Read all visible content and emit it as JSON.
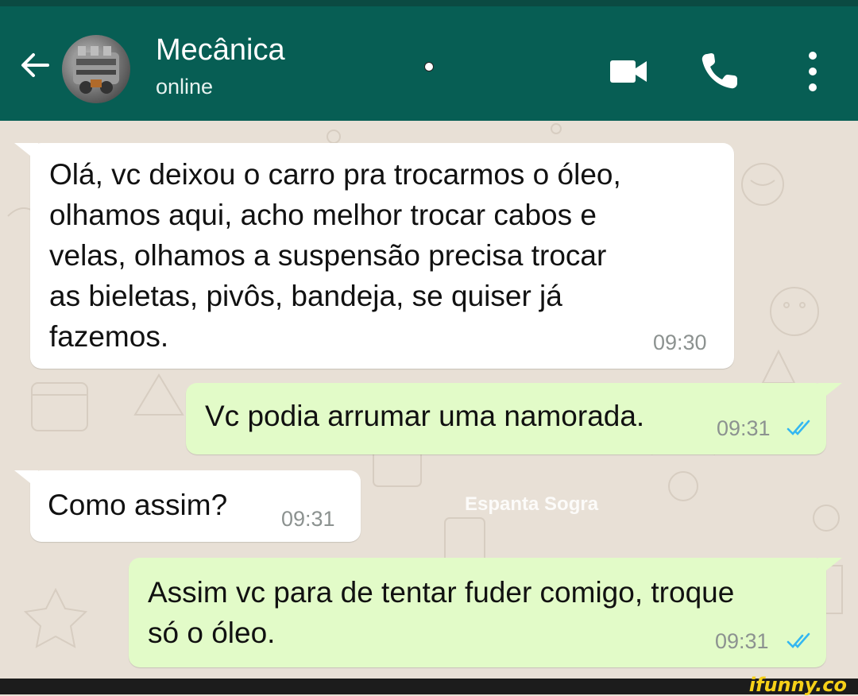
{
  "header": {
    "contact_name": "Mecânica",
    "status": "online",
    "icons": [
      "back-arrow-icon",
      "video-call-icon",
      "voice-call-icon",
      "more-options-icon"
    ]
  },
  "messages": [
    {
      "direction": "in",
      "text_lines": [
        "Olá, vc deixou o carro pra trocarmos o óleo,",
        "olhamos aqui, acho melhor trocar cabos e",
        "velas, olhamos a suspensão precisa trocar",
        "as bieletas, pivôs, bandeja, se quiser já",
        "fazemos."
      ],
      "time": "09:30"
    },
    {
      "direction": "out",
      "text_lines": [
        "Vc podia arrumar uma namorada."
      ],
      "time": "09:31",
      "status": "read"
    },
    {
      "direction": "in",
      "text_lines": [
        "Como assim?"
      ],
      "time": "09:31"
    },
    {
      "direction": "out",
      "text_lines": [
        "Assim vc para de tentar fuder comigo, troque",
        "só o óleo."
      ],
      "time": "09:31",
      "status": "read"
    }
  ],
  "watermark": "Espanta Sogra",
  "footer_brand": "ifunny.co",
  "colors": {
    "header": "#075e54",
    "incoming_bubble": "#ffffff",
    "outgoing_bubble": "#e2fbc8",
    "read_ticks": "#34b7f1",
    "chat_background": "#e8e0d6"
  }
}
